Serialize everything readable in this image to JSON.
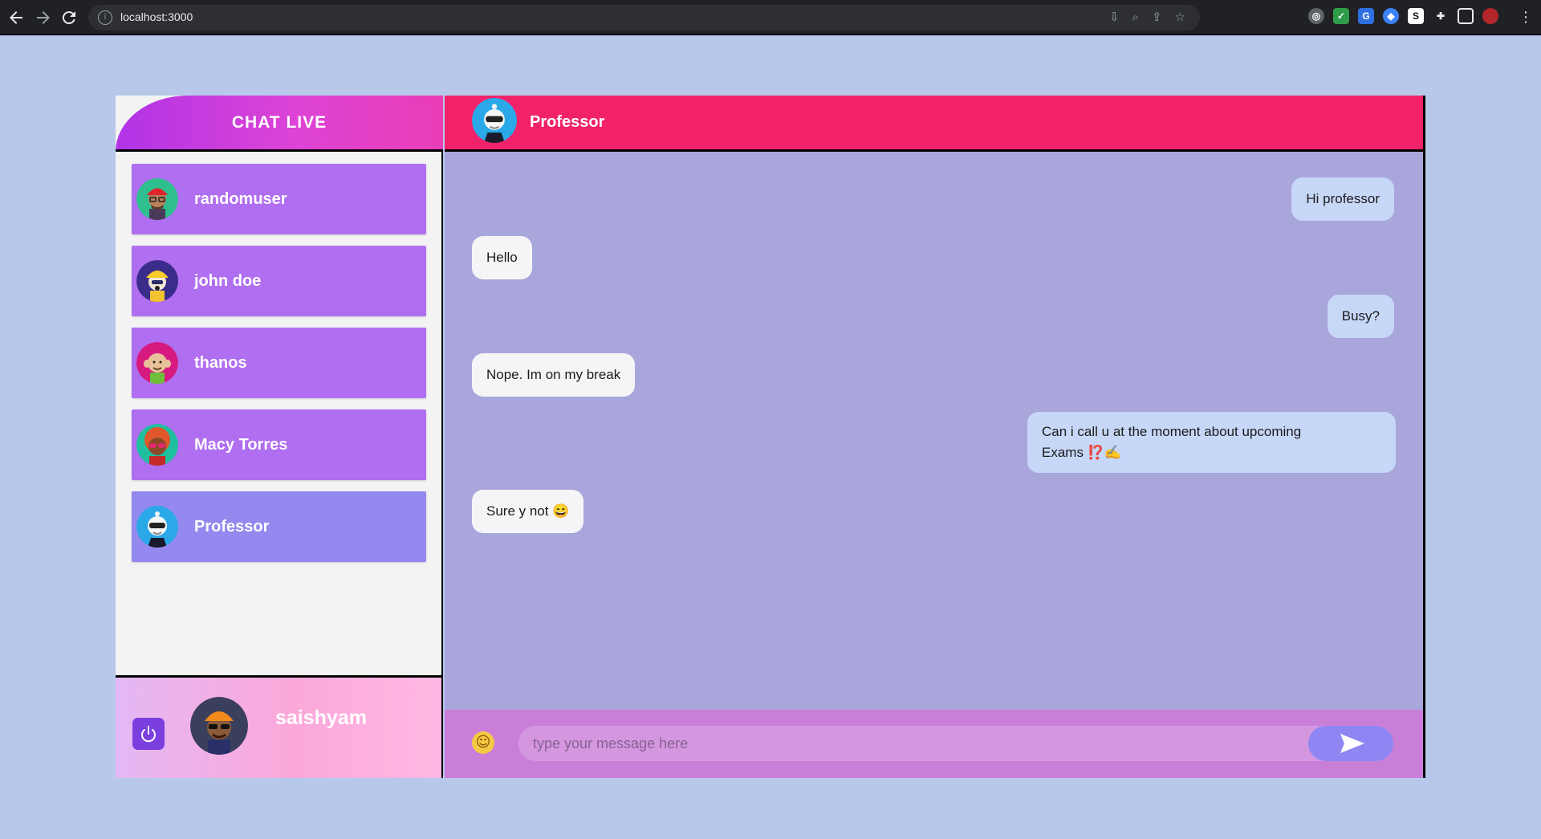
{
  "browser": {
    "url": "localhost:3000",
    "menu_icon": "more-vertical-icon"
  },
  "sidebar": {
    "brand_title": "CHAT LIVE",
    "contacts": [
      {
        "name": "randomuser",
        "avatar": "red-cap-avatar"
      },
      {
        "name": "john doe",
        "avatar": "hard-hat-avatar"
      },
      {
        "name": "thanos",
        "avatar": "bald-elder-avatar"
      },
      {
        "name": "Macy Torres",
        "avatar": "red-glasses-avatar"
      },
      {
        "name": "Professor",
        "avatar": "professor-avatar",
        "active": true
      }
    ],
    "current_user": {
      "name": "saishyam",
      "avatar": "turban-sunglasses-avatar"
    }
  },
  "chat": {
    "header_name": "Professor",
    "messages": [
      {
        "direction": "out",
        "text": "Hi professor"
      },
      {
        "direction": "in",
        "text": "Hello"
      },
      {
        "direction": "out",
        "text": "Busy?"
      },
      {
        "direction": "in",
        "text": "Nope. Im on my break"
      },
      {
        "direction": "out",
        "line1": "Can i call u at the moment about upcoming",
        "line2": "Exams ⁉️✍️"
      },
      {
        "direction": "in",
        "text": "Sure y not 😄"
      }
    ],
    "composer": {
      "placeholder": "type your message here",
      "emoji_icon": "smiley-icon",
      "send_icon": "send-icon"
    }
  },
  "colors": {
    "page_bg": "#b8c8ea",
    "contact_bg": "#b06ef0",
    "contact_active_bg": "#9489ef",
    "chat_header": "#f2226a",
    "chat_bg": "#a9a6dc",
    "out_bubble": "#c7d7f7",
    "in_bubble": "#f5f5f7",
    "composer_bg": "#c97fd8"
  }
}
